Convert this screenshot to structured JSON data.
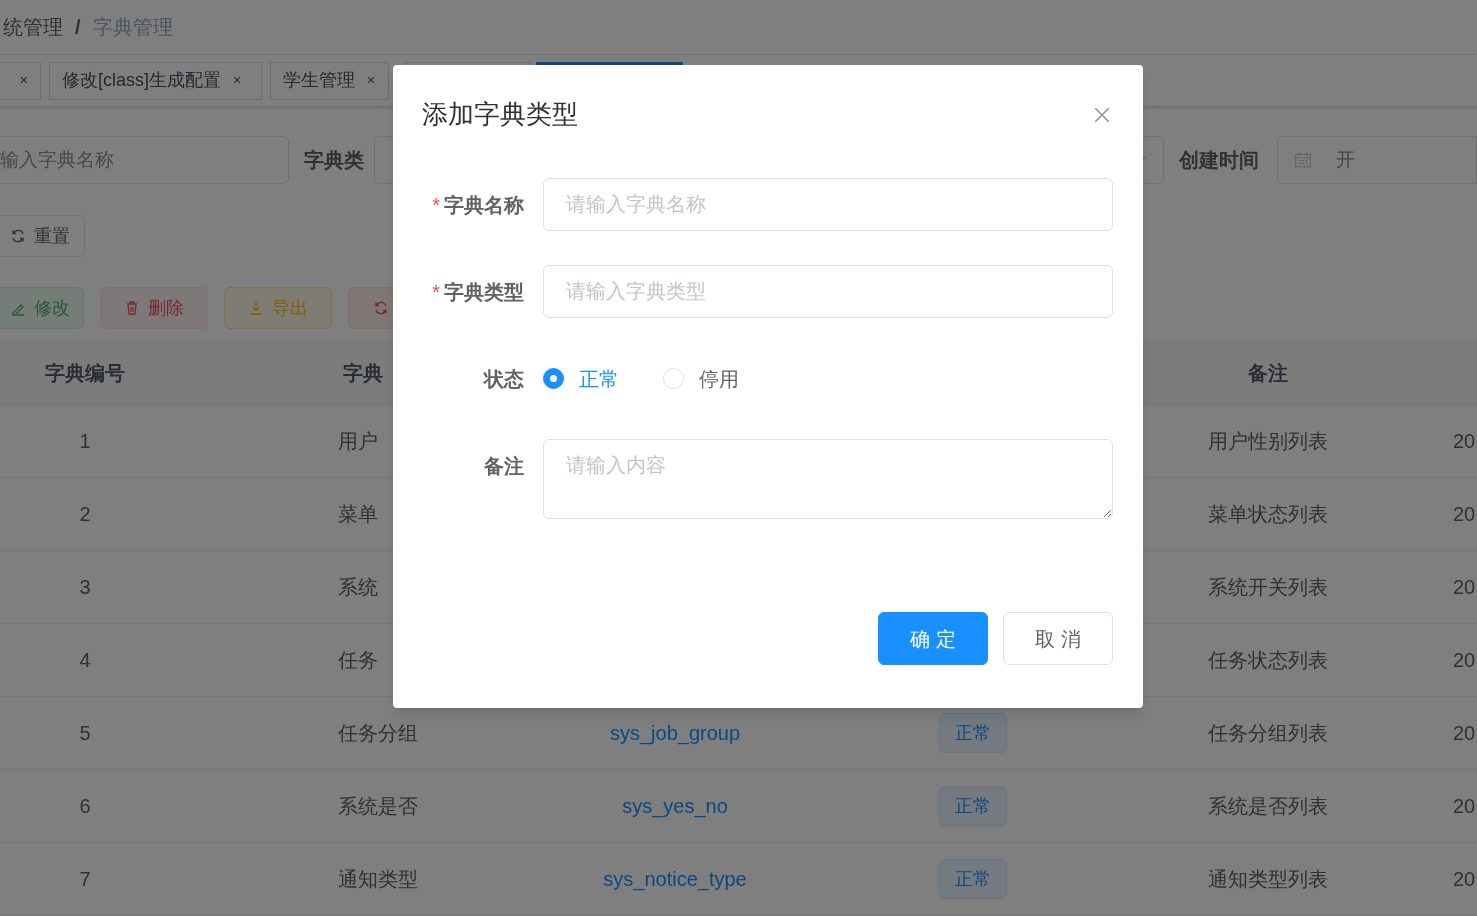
{
  "breadcrumb": {
    "items": [
      "统管理",
      "字典管理"
    ],
    "separator": "/"
  },
  "tabs": [
    {
      "close": "×",
      "selected": false
    },
    {
      "label": "修改[class]生成配置",
      "close": "×",
      "selected": false
    },
    {
      "label": "学生管理",
      "close": "×",
      "selected": false
    },
    {
      "selected": false
    },
    {
      "selected": true
    }
  ],
  "search": {
    "name_field": {
      "placeholder": "输入字典名称"
    },
    "type_label": "字典类",
    "created_label": "创建时间",
    "date_field": {
      "placeholder": "开"
    },
    "reset_button": "重置"
  },
  "toolbar": [
    {
      "kind": "edit",
      "label": "修改",
      "disabled": true
    },
    {
      "kind": "delete",
      "label": "删除",
      "disabled": true
    },
    {
      "kind": "export",
      "label": "导出",
      "disabled": false
    },
    {
      "kind": "refresh",
      "disabled": false
    }
  ],
  "table": {
    "columns": [
      {
        "label": "字典编号"
      },
      {
        "label": "字典"
      },
      {},
      {},
      {
        "label": "备注"
      },
      {}
    ],
    "rows": [
      {
        "id": "1",
        "name": "用户",
        "remark": "用户性别列表",
        "created": "20"
      },
      {
        "id": "2",
        "name": "菜单",
        "remark": "菜单状态列表",
        "created": "20"
      },
      {
        "id": "3",
        "name": "系统",
        "remark": "系统开关列表",
        "created": "20"
      },
      {
        "id": "4",
        "name": "任务",
        "remark": "任务状态列表",
        "created": "20"
      },
      {
        "id": "5",
        "name": "任务分组",
        "type": "sys_job_group",
        "status": "正常",
        "remark": "任务分组列表",
        "created": "20"
      },
      {
        "id": "6",
        "name": "系统是否",
        "type": "sys_yes_no",
        "status": "正常",
        "remark": "系统是否列表",
        "created": "20"
      },
      {
        "id": "7",
        "name": "通知类型",
        "type": "sys_notice_type",
        "status": "正常",
        "remark": "通知类型列表",
        "created": "20"
      }
    ]
  },
  "dialog": {
    "title": "添加字典类型",
    "fields": [
      {
        "kind": "input",
        "label": "字典名称",
        "required_mark": "*",
        "placeholder": "请输入字典名称"
      },
      {
        "kind": "input",
        "label": "字典类型",
        "required_mark": "*",
        "placeholder": "请输入字典类型"
      },
      {
        "kind": "radio",
        "label": "状态",
        "options": [
          {
            "label": "正常",
            "selected": true
          },
          {
            "label": "停用",
            "selected": false
          }
        ]
      },
      {
        "kind": "textarea",
        "label": "备注",
        "placeholder": "请输入内容"
      }
    ],
    "buttons": [
      {
        "kind": "primary",
        "label": "确 定"
      },
      {
        "kind": "default",
        "label": "取 消"
      }
    ]
  }
}
